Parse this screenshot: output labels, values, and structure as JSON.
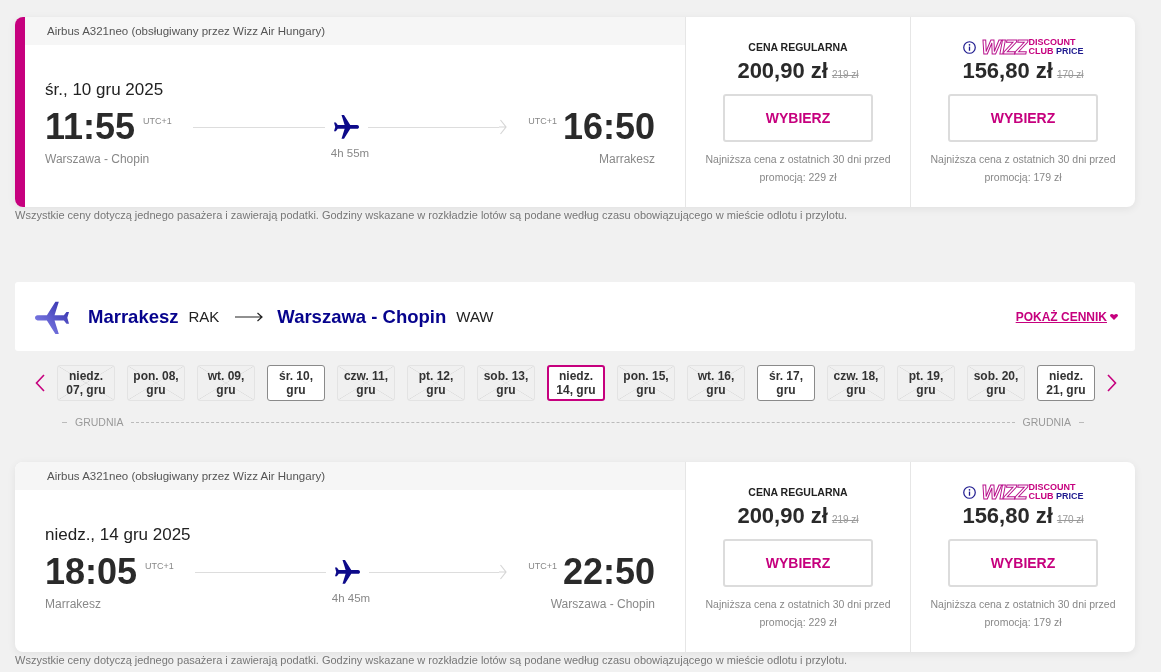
{
  "outbound": {
    "flight": {
      "selected": true,
      "aircraft": "Airbus A321neo (obsługiwany przez Wizz Air Hungary)",
      "date": "śr., 10 gru 2025",
      "departure": {
        "time": "11:55",
        "timezone": "UTC+1",
        "city": "Warszawa - Chopin"
      },
      "duration": "4h 55m",
      "arrival": {
        "time": "16:50",
        "timezone": "UTC+1",
        "city": "Marrakesz"
      },
      "fares": [
        {
          "kind": "regular",
          "label": "CENA REGULARNA",
          "price": "200,90 zł",
          "old_price": "219 zł",
          "button": "WYBIERZ",
          "note": "Najniższa cena z ostatnich 30 dni przed promocją: 229 zł"
        },
        {
          "kind": "club",
          "logo": {
            "wordmark": "WIZZ",
            "lines": [
              [
                "DISCOUNT"
              ],
              [
                "CLUB",
                "PRICE"
              ]
            ]
          },
          "price": "156,80 zł",
          "old_price": "170 zł",
          "button": "WYBIERZ",
          "note": "Najniższa cena z ostatnich 30 dni przed promocją: 179 zł"
        }
      ]
    },
    "disclaimer": "Wszystkie ceny dotyczą jednego pasażera i zawierają podatki. Godziny wskazane w rozkładzie lotów są podane według czasu obowiązującego w mieście odlotu i przylotu."
  },
  "inbound": {
    "route": {
      "origin": "Marrakesz",
      "origin_code": "RAK",
      "destination": "Warszawa - Chopin",
      "destination_code": "WAW"
    },
    "price_list_link": "POKAŻ CENNIK",
    "date_strip": {
      "dates": [
        {
          "label": "niedz. 07, gru",
          "available": false,
          "selected": false
        },
        {
          "label": "pon. 08, gru",
          "available": false,
          "selected": false
        },
        {
          "label": "wt. 09, gru",
          "available": false,
          "selected": false
        },
        {
          "label": "śr. 10, gru",
          "available": true,
          "selected": false
        },
        {
          "label": "czw. 11, gru",
          "available": false,
          "selected": false
        },
        {
          "label": "pt. 12, gru",
          "available": false,
          "selected": false
        },
        {
          "label": "sob. 13, gru",
          "available": false,
          "selected": false
        },
        {
          "label": "niedz. 14, gru",
          "available": true,
          "selected": true
        },
        {
          "label": "pon. 15, gru",
          "available": false,
          "selected": false
        },
        {
          "label": "wt. 16, gru",
          "available": false,
          "selected": false
        },
        {
          "label": "śr. 17, gru",
          "available": true,
          "selected": false
        },
        {
          "label": "czw. 18, gru",
          "available": false,
          "selected": false
        },
        {
          "label": "pt. 19, gru",
          "available": false,
          "selected": false
        },
        {
          "label": "sob. 20, gru",
          "available": false,
          "selected": false
        },
        {
          "label": "niedz. 21, gru",
          "available": true,
          "selected": false
        }
      ],
      "months": [
        "GRUDNIA",
        "GRUDNIA"
      ]
    },
    "flight": {
      "selected": false,
      "aircraft": "Airbus A321neo (obsługiwany przez Wizz Air Hungary)",
      "date": "niedz., 14 gru 2025",
      "departure": {
        "time": "18:05",
        "timezone": "UTC+1",
        "city": "Marrakesz"
      },
      "duration": "4h 45m",
      "arrival": {
        "time": "22:50",
        "timezone": "UTC+1",
        "city": "Warszawa - Chopin"
      },
      "fares": [
        {
          "kind": "regular",
          "label": "CENA REGULARNA",
          "price": "200,90 zł",
          "old_price": "219 zł",
          "button": "WYBIERZ",
          "note": "Najniższa cena z ostatnich 30 dni przed promocją: 229 zł"
        },
        {
          "kind": "club",
          "logo": {
            "wordmark": "WIZZ",
            "lines": [
              [
                "DISCOUNT"
              ],
              [
                "CLUB",
                "PRICE"
              ]
            ]
          },
          "price": "156,80 zł",
          "old_price": "170 zł",
          "button": "WYBIERZ",
          "note": "Najniższa cena z ostatnich 30 dni przed promocją: 179 zł"
        }
      ]
    },
    "disclaimer": "Wszystkie ceny dotyczą jednego pasażera i zawierają podatki. Godziny wskazane w rozkładzie lotów są podane według czasu obowiązującego w mieście odlotu i przylotu."
  }
}
